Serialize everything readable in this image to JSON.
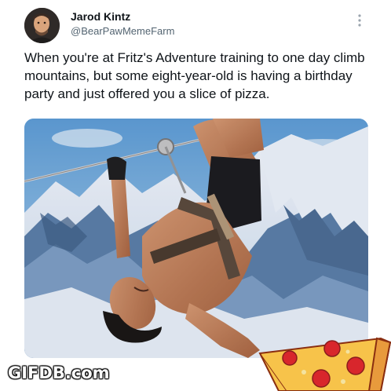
{
  "tweet": {
    "author_name": "Jarod Kintz",
    "author_handle": "@BearPawMemeFarm",
    "text": "When you're at Fritz's Adventure training to one day climb mountains, but some eight-year-old is having a birthday party and just offered you a slice of pizza.",
    "more_icon": "vertical-ellipsis-icon"
  },
  "media": {
    "subject": "man-upside-down-on-zipline-over-snowy-mountains-image"
  },
  "overlay": {
    "sticker_icon": "pizza-slice-icon",
    "watermark": "GIFDB.com"
  },
  "colors": {
    "text_primary": "#0f1419",
    "text_secondary": "#536471",
    "sky": "#7fb3e0",
    "snow": "#eef4fb",
    "rock": "#4f6f93",
    "pizza_crust": "#e89a3c",
    "pizza_cheese": "#f7c34a",
    "pepperoni": "#d8262c"
  }
}
